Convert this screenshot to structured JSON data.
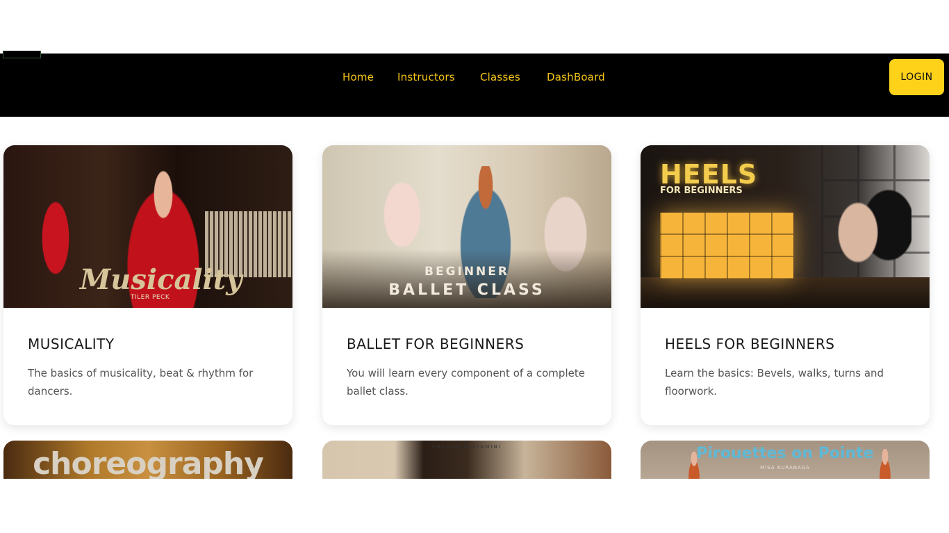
{
  "nav": {
    "links": [
      "Home",
      "Instructors",
      "Classes",
      "DashBoard"
    ],
    "login_label": "LOGIN"
  },
  "colors": {
    "nav_background": "#000000",
    "nav_link": "#f5c518",
    "login_button": "#ffd21a"
  },
  "classes": [
    {
      "title": "MUSICALITY",
      "description": "The basics of musicality, beat & rhythm for dancers.",
      "image_title": "Musicality",
      "image_subtitle": "TILER PECK"
    },
    {
      "title": "BALLET FOR BEGINNERS",
      "description": "You will learn every component of a complete ballet class.",
      "image_title_top": "BEGINNER",
      "image_title_bottom": "BALLET CLASS"
    },
    {
      "title": "HEELS FOR BEGINNERS",
      "description": "Learn the basics: Bevels, walks, turns and floorwork.",
      "image_title": "HEELS",
      "image_subtitle": "FOR BEGINNERS"
    }
  ],
  "more_classes": [
    {
      "image_title": "choreography"
    },
    {
      "image_subtitle": "SHAHAR BINYAMINI"
    },
    {
      "image_title": "Pirouettes on Pointe",
      "image_subtitle": "MISA KURANAGA"
    }
  ]
}
